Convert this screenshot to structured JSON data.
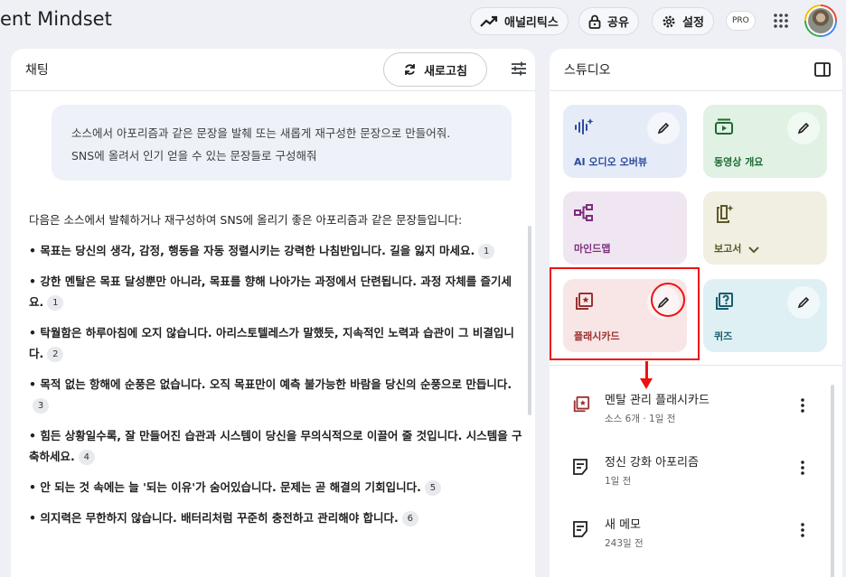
{
  "header": {
    "title": "ent Mindset",
    "analytics_label": "애널리틱스",
    "share_label": "공유",
    "settings_label": "설정",
    "pro_badge": "PRO"
  },
  "chat": {
    "title": "채팅",
    "refresh_label": "새로고침",
    "user_message_line1": "소스에서 아포리즘과 같은 문장을 발췌 또는 새롭게 재구성한 문장으로 만들어줘.",
    "user_message_line2": "SNS에 올려서 인기 얻을 수 있는 문장들로 구성해줘",
    "response_intro": "다음은 소스에서 발췌하거나 재구성하여 SNS에 올리기 좋은 아포리즘과 같은 문장들입니다:",
    "bullets": [
      {
        "text": "• 목표는 당신의 생각, 감정, 행동을 자동 정렬시키는 강력한 나침반입니다. 길을 잃지 마세요.",
        "cite": "1"
      },
      {
        "text": "• 강한 멘탈은 목표 달성뿐만 아니라, 목표를 향해 나아가는 과정에서 단련됩니다. 과정 자체를 즐기세요.",
        "cite": "1"
      },
      {
        "text": "• 탁월함은 하루아침에 오지 않습니다. 아리스토텔레스가 말했듯, 지속적인 노력과 습관이 그 비결입니다.",
        "cite": "2"
      },
      {
        "text": "• 목적 없는 항해에 순풍은 없습니다. 오직 목표만이 예측 불가능한 바람을 당신의 순풍으로 만듭니다.",
        "cite": "3"
      },
      {
        "text": "• 힘든 상황일수록, 잘 만들어진 습관과 시스템이 당신을 무의식적으로 이끌어 줄 것입니다. 시스템을 구축하세요.",
        "cite": "4"
      },
      {
        "text": "• 안 되는 것 속에는 늘 '되는 이유'가 숨어있습니다. 문제는 곧 해결의 기회입니다.",
        "cite": "5"
      },
      {
        "text": "• 의지력은 무한하지 않습니다. 배터리처럼 꾸준히 충전하고 관리해야 합니다.",
        "cite": "6"
      }
    ]
  },
  "studio": {
    "title": "스튜디오",
    "cards": [
      {
        "label": "AI 오디오 오버뷰",
        "icon": "audio-waveform-icon"
      },
      {
        "label": "동영상 개요",
        "icon": "video-overview-icon"
      },
      {
        "label": "마인드맵",
        "icon": "mindmap-icon"
      },
      {
        "label": "보고서",
        "icon": "report-icon"
      },
      {
        "label": "플래시카드",
        "icon": "flashcard-icon"
      },
      {
        "label": "퀴즈",
        "icon": "quiz-icon"
      }
    ],
    "notes": [
      {
        "title": "멘탈 관리 플래시카드",
        "subtitle": "소스 6개 · 1일 전",
        "icon": "flashcard-icon"
      },
      {
        "title": "정신 강화 아포리즘",
        "subtitle": "1일 전",
        "icon": "note-icon"
      },
      {
        "title": "새 메모",
        "subtitle": "243일 전",
        "icon": "note-icon"
      }
    ]
  },
  "colors": {
    "annotation_red": "#ee1111",
    "audio_card": "#e6ebf8",
    "video_card": "#e1f1e4",
    "mindmap_card": "#f0e6f1",
    "report_card": "#f1efe2",
    "flashcard_card": "#f8e6e6",
    "quiz_card": "#dff0f4"
  }
}
